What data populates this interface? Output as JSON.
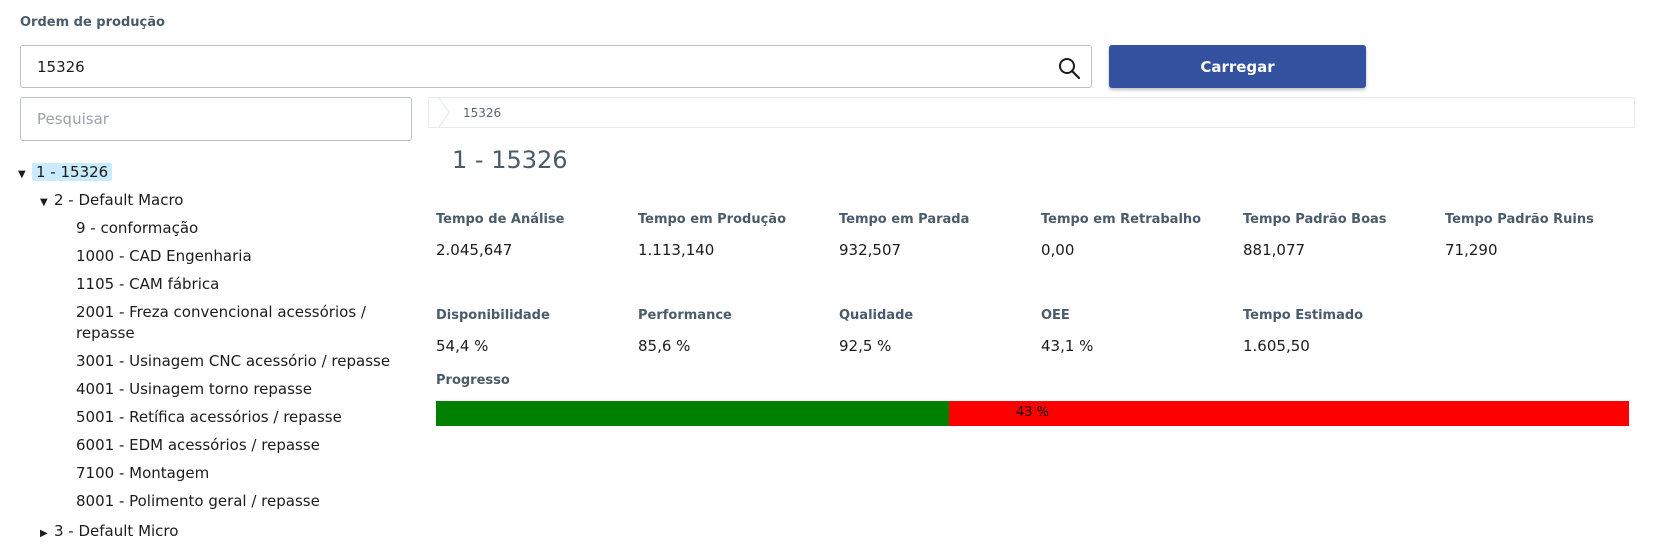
{
  "order": {
    "label": "Ordem de produção",
    "value": "15326",
    "load_button": "Carregar"
  },
  "tree": {
    "search_placeholder": "Pesquisar",
    "root": "1 - 15326",
    "macro": "2 - Default Macro",
    "macro_children": [
      "9 - conformação",
      "1000 - CAD Engenharia",
      "1105 - CAM fábrica",
      "2001 - Freza convencional acessórios /",
      "repasse",
      "3001 - Usinagem CNC acessório / repasse",
      "4001 - Usinagem torno repasse",
      "5001 - Retífica acessórios / repasse",
      "6001 - EDM acessórios / repasse",
      "7100 - Montagem",
      "8001 - Polimento geral / repasse"
    ],
    "micro": "3 - Default Micro"
  },
  "detail": {
    "breadcrumb": "15326",
    "title": "1 - 15326",
    "metrics_row1": [
      {
        "label": "Tempo de Análise",
        "value": "2.045,647"
      },
      {
        "label": "Tempo em Produção",
        "value": "1.113,140"
      },
      {
        "label": "Tempo em Parada",
        "value": "932,507"
      },
      {
        "label": "Tempo em Retrabalho",
        "value": "0,00"
      },
      {
        "label": "Tempo Padrão Boas",
        "value": "881,077"
      },
      {
        "label": "Tempo Padrão Ruins",
        "value": "71,290"
      }
    ],
    "metrics_row2": [
      {
        "label": "Disponibilidade",
        "value": "54,4 %"
      },
      {
        "label": "Performance",
        "value": "85,6 %"
      },
      {
        "label": "Qualidade",
        "value": "92,5 %"
      },
      {
        "label": "OEE",
        "value": "43,1 %"
      },
      {
        "label": "Tempo Estimado",
        "value": "1.605,50"
      }
    ],
    "progress": {
      "label": "Progresso",
      "text": "43 %",
      "fraction": 0.43,
      "fill_color": "#008000",
      "track_color": "#ff0000"
    }
  },
  "colors": {
    "primary": "#3451a0",
    "selected_bg": "#c9ebfb"
  }
}
